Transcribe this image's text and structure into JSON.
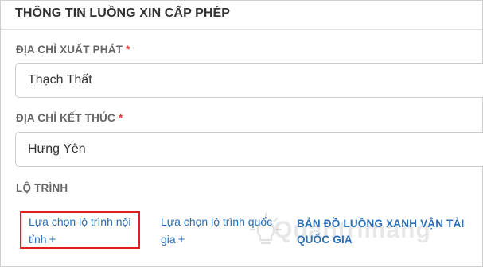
{
  "section_title": "THÔNG TIN LUỒNG XIN CẤP PHÉP",
  "start_address": {
    "label": "ĐỊA CHỈ XUẤT PHÁT",
    "required_mark": "*",
    "value": "Thạch Thất"
  },
  "end_address": {
    "label": "ĐỊA CHỈ KẾT THÚC",
    "required_mark": "*",
    "value": "Hưng Yên"
  },
  "route": {
    "label": "LỘ TRÌNH",
    "domestic_line1": "Lựa chọn lộ trình nội",
    "domestic_line2": "tỉnh",
    "national_line1": "Lựa chọn lộ trình quốc",
    "national_line2": "gia",
    "plus": "+",
    "map_line1": "BẢN ĐỒ LUỒNG XANH VẬN TẢI",
    "map_line2": "QUỐC GIA"
  },
  "watermark": {
    "text": "Quantrimang"
  },
  "colors": {
    "link": "#2b6fb6",
    "required": "#e53935",
    "highlight_box": "#e01e1e"
  },
  "icons": {
    "watermark_logo": "lightbulb-logo-icon"
  }
}
